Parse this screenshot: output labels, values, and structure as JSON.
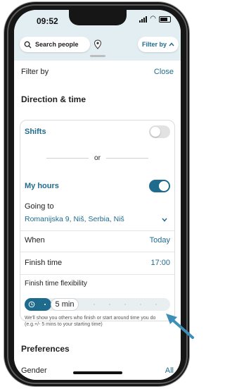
{
  "status": {
    "time": "09:52"
  },
  "topbar": {
    "search_label": "Search people",
    "filter_label": "Filter by",
    "filter_chevron": "chevron-up-icon",
    "location_icon": "location-pin-icon"
  },
  "sheet": {
    "title": "Filter by",
    "close": "Close",
    "section_direction": "Direction & time",
    "shifts_label": "Shifts",
    "shifts_on": false,
    "or_label": "or",
    "my_hours_label": "My hours",
    "my_hours_on": true,
    "going_to_label": "Going to",
    "going_to_value": "Romanijska 9, Niš, Serbia, Niš",
    "when_label": "When",
    "when_value": "Today",
    "finish_time_label": "Finish time",
    "finish_time_value": "17:00",
    "flex_label": "Finish time flexibility",
    "flex_value": "5 min",
    "flex_hint": "We'll show you others who finish or start around time you do (e.g.+/- 5 mins to your starting time)",
    "section_preferences": "Preferences",
    "gender_label": "Gender",
    "gender_value": "All"
  },
  "colors": {
    "accent": "#1f6b8e",
    "map_bg": "#e3eef3",
    "arrow": "#3d8fb8"
  }
}
